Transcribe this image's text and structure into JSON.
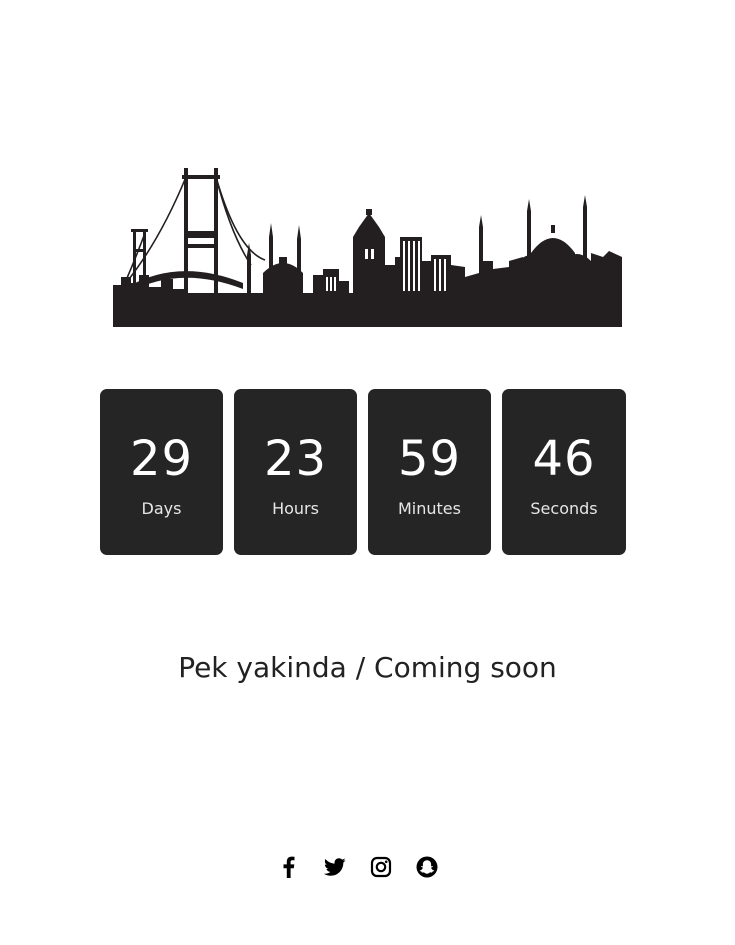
{
  "countdown": {
    "units": [
      {
        "value": "29",
        "label": "Days"
      },
      {
        "value": "23",
        "label": "Hours"
      },
      {
        "value": "59",
        "label": "Minutes"
      },
      {
        "value": "46",
        "label": "Seconds"
      }
    ]
  },
  "headline": "Pek yakinda / Coming soon",
  "social": {
    "icons": [
      "facebook-icon",
      "twitter-icon",
      "instagram-icon",
      "snapchat-icon"
    ]
  },
  "colors": {
    "tile_background": "#252525",
    "tile_text": "#ffffff",
    "skyline": "#231f20",
    "headline": "#222222"
  }
}
